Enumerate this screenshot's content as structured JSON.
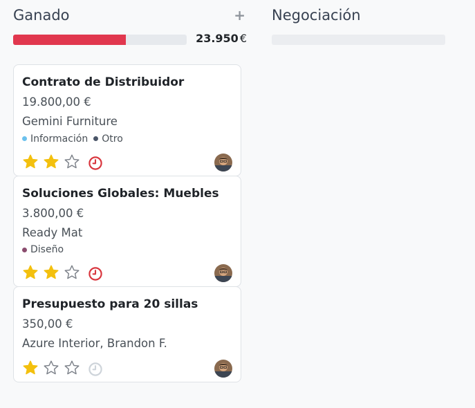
{
  "columns": [
    {
      "title": "Ganado",
      "progress_fraction": 0.65,
      "progress_color": "#e1374e",
      "total": "23.950",
      "currency": "€",
      "add_icon": "plus-icon"
    },
    {
      "title": "Negociación",
      "progress_fraction": 0
    }
  ],
  "cards": [
    {
      "title": "Contrato de Distribuidor",
      "amount": "19.800,00 €",
      "partner": "Gemini Furniture",
      "tags": [
        {
          "label": "Información",
          "color": "#6cc1ed"
        },
        {
          "label": "Otro",
          "color": "#4a5568"
        }
      ],
      "stars": 2,
      "activity": "overdue",
      "activity_color": "#d9363e"
    },
    {
      "title": "Soluciones Globales: Muebles",
      "amount": "3.800,00 €",
      "partner": "Ready Mat",
      "tags": [
        {
          "label": "Diseño",
          "color": "#8b4c6e"
        }
      ],
      "stars": 2,
      "activity": "overdue",
      "activity_color": "#d9363e"
    },
    {
      "title": "Presupuesto para 20 sillas",
      "amount": "350,00 €",
      "partner": "Azure Interior, Brandon F.",
      "tags": [],
      "stars": 1,
      "activity": "none",
      "activity_color": "#ced4da"
    }
  ],
  "star_color": "#f3c00e",
  "star_empty_color": "#7b8088"
}
